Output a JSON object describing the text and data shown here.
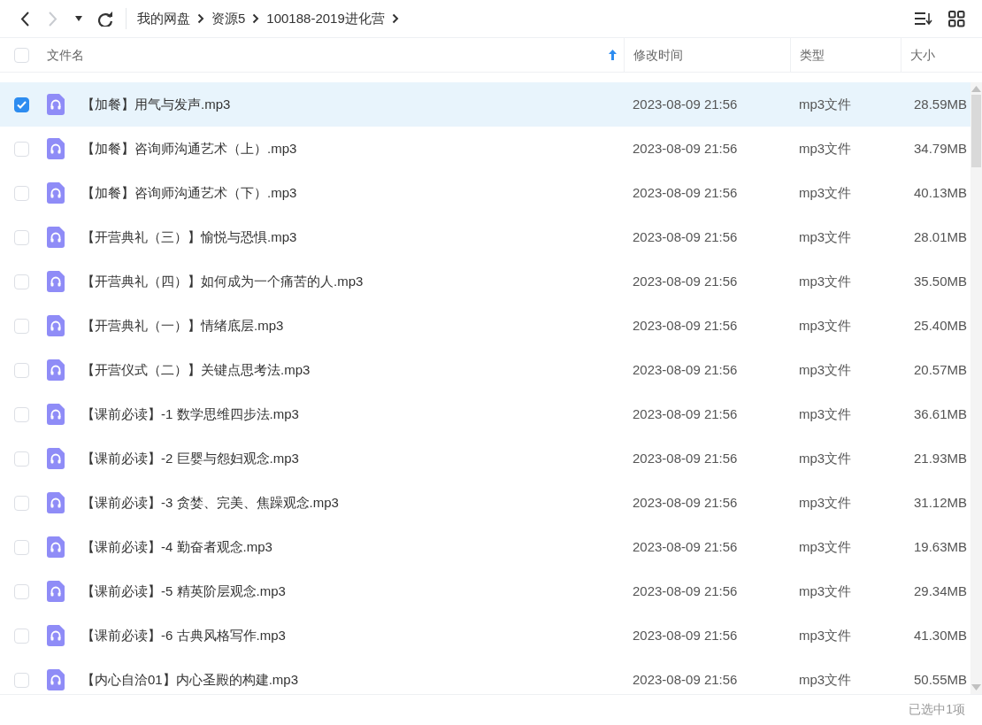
{
  "nav_buttons": [
    {
      "kind": "back",
      "disabled": false
    },
    {
      "kind": "forward",
      "disabled": true
    },
    {
      "kind": "history",
      "disabled": false
    },
    {
      "kind": "refresh",
      "disabled": false
    }
  ],
  "breadcrumb": [
    "我的网盘",
    "资源5",
    "100188-2019进化营"
  ],
  "view_buttons": [
    {
      "kind": "sort"
    },
    {
      "kind": "grid"
    }
  ],
  "header_checkbox": {
    "checked": false
  },
  "columns": [
    {
      "label": "文件名",
      "sorted": true
    },
    {
      "label": "修改时间",
      "sorted": false
    },
    {
      "label": "类型",
      "sorted": false
    },
    {
      "label": "大小",
      "sorted": false
    }
  ],
  "rows": [
    {
      "name": "【加餐】用气与发声.mp3",
      "modified": "2023-08-09 21:56",
      "type": "mp3文件",
      "size": "28.59MB",
      "selected": true
    },
    {
      "name": "【加餐】咨询师沟通艺术（上）.mp3",
      "modified": "2023-08-09 21:56",
      "type": "mp3文件",
      "size": "34.79MB",
      "selected": false
    },
    {
      "name": "【加餐】咨询师沟通艺术（下）.mp3",
      "modified": "2023-08-09 21:56",
      "type": "mp3文件",
      "size": "40.13MB",
      "selected": false
    },
    {
      "name": "【开营典礼（三）】愉悦与恐惧.mp3",
      "modified": "2023-08-09 21:56",
      "type": "mp3文件",
      "size": "28.01MB",
      "selected": false
    },
    {
      "name": "【开营典礼（四）】如何成为一个痛苦的人.mp3",
      "modified": "2023-08-09 21:56",
      "type": "mp3文件",
      "size": "35.50MB",
      "selected": false
    },
    {
      "name": "【开营典礼（一）】情绪底层.mp3",
      "modified": "2023-08-09 21:56",
      "type": "mp3文件",
      "size": "25.40MB",
      "selected": false
    },
    {
      "name": "【开营仪式（二）】关键点思考法.mp3",
      "modified": "2023-08-09 21:56",
      "type": "mp3文件",
      "size": "20.57MB",
      "selected": false
    },
    {
      "name": "【课前必读】-1 数学思维四步法.mp3",
      "modified": "2023-08-09 21:56",
      "type": "mp3文件",
      "size": "36.61MB",
      "selected": false
    },
    {
      "name": "【课前必读】-2 巨婴与怨妇观念.mp3",
      "modified": "2023-08-09 21:56",
      "type": "mp3文件",
      "size": "21.93MB",
      "selected": false
    },
    {
      "name": "【课前必读】-3 贪婪、完美、焦躁观念.mp3",
      "modified": "2023-08-09 21:56",
      "type": "mp3文件",
      "size": "31.12MB",
      "selected": false
    },
    {
      "name": "【课前必读】-4 勤奋者观念.mp3",
      "modified": "2023-08-09 21:56",
      "type": "mp3文件",
      "size": "19.63MB",
      "selected": false
    },
    {
      "name": "【课前必读】-5 精英阶层观念.mp3",
      "modified": "2023-08-09 21:56",
      "type": "mp3文件",
      "size": "29.34MB",
      "selected": false
    },
    {
      "name": "【课前必读】-6 古典风格写作.mp3",
      "modified": "2023-08-09 21:56",
      "type": "mp3文件",
      "size": "41.30MB",
      "selected": false
    },
    {
      "name": "【内心自洽01】内心圣殿的构建.mp3",
      "modified": "2023-08-09 21:56",
      "type": "mp3文件",
      "size": "50.55MB",
      "selected": false
    }
  ],
  "status_bar": "已选中1项"
}
